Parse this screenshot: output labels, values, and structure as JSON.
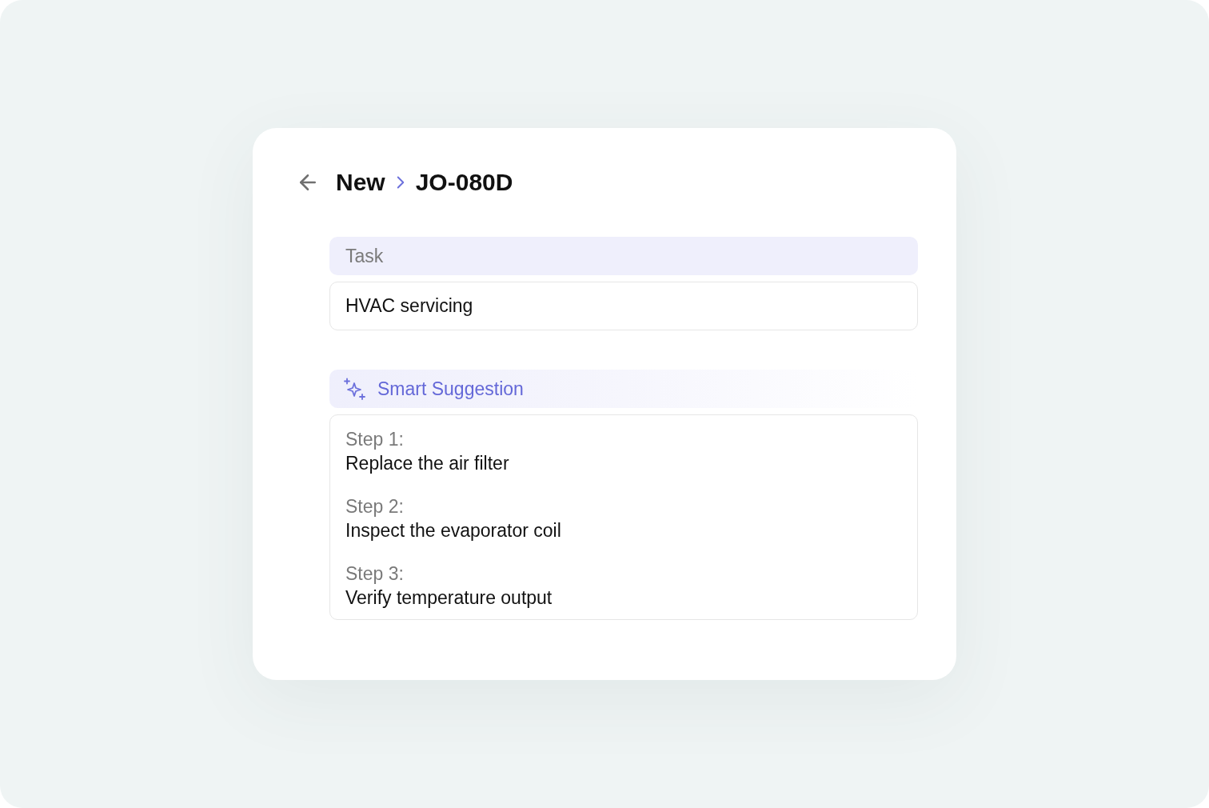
{
  "header": {
    "breadcrumb": [
      "New",
      "JO-080D"
    ]
  },
  "task": {
    "label": "Task",
    "value": "HVAC servicing"
  },
  "suggestion": {
    "title": "Smart Suggestion",
    "steps": [
      {
        "label": "Step 1:",
        "text": "Replace the air filter"
      },
      {
        "label": "Step 2:",
        "text": "Inspect the evaporator coil"
      },
      {
        "label": "Step 3:",
        "text": "Verify temperature output"
      }
    ]
  }
}
